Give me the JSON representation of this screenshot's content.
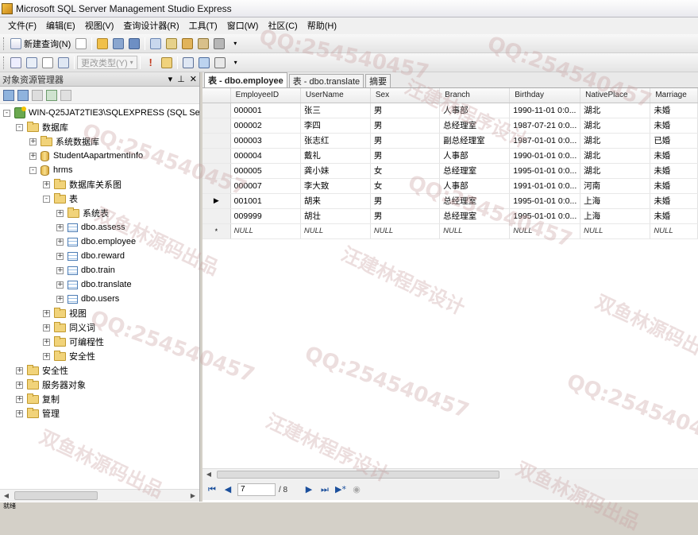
{
  "window": {
    "title": "Microsoft SQL Server Management Studio Express"
  },
  "menu": [
    "文件(F)",
    "编辑(E)",
    "视图(V)",
    "查询设计器(R)",
    "工具(T)",
    "窗口(W)",
    "社区(C)",
    "帮助(H)"
  ],
  "toolbar": {
    "new_query": "新建查询(N)",
    "change_type": "更改类型(Y)"
  },
  "object_explorer": {
    "title": "对象资源管理器",
    "pin": "▼ 📌 ✕",
    "tree": [
      {
        "label": "WIN-Q25JAT2TIE3\\SQLEXPRESS (SQL Ser",
        "icon": "server-icon",
        "exp": "-"
      },
      {
        "label": "数据库",
        "icon": "folder-icon",
        "exp": "-"
      },
      {
        "label": "系统数据库",
        "icon": "folder-icon",
        "exp": "+"
      },
      {
        "label": "StudentAapartmentInfo",
        "icon": "database-icon",
        "exp": "+"
      },
      {
        "label": "hrms",
        "icon": "database-icon",
        "exp": "-"
      },
      {
        "label": "数据库关系图",
        "icon": "folder-icon",
        "exp": "+"
      },
      {
        "label": "表",
        "icon": "folder-icon",
        "exp": "-"
      },
      {
        "label": "系统表",
        "icon": "folder-icon",
        "exp": "+"
      },
      {
        "label": "dbo.assess",
        "icon": "table-icon",
        "exp": "+"
      },
      {
        "label": "dbo.employee",
        "icon": "table-icon",
        "exp": "+"
      },
      {
        "label": "dbo.reward",
        "icon": "table-icon",
        "exp": "+"
      },
      {
        "label": "dbo.train",
        "icon": "table-icon",
        "exp": "+"
      },
      {
        "label": "dbo.translate",
        "icon": "table-icon",
        "exp": "+"
      },
      {
        "label": "dbo.users",
        "icon": "table-icon",
        "exp": "+"
      },
      {
        "label": "视图",
        "icon": "folder-icon",
        "exp": "+"
      },
      {
        "label": "同义词",
        "icon": "folder-icon",
        "exp": "+"
      },
      {
        "label": "可编程性",
        "icon": "folder-icon",
        "exp": "+"
      },
      {
        "label": "安全性",
        "icon": "folder-icon",
        "exp": "+"
      },
      {
        "label": "安全性",
        "icon": "folder-icon",
        "exp": "+"
      },
      {
        "label": "服务器对象",
        "icon": "folder-icon",
        "exp": "+"
      },
      {
        "label": "复制",
        "icon": "folder-icon",
        "exp": "+"
      },
      {
        "label": "管理",
        "icon": "folder-icon",
        "exp": "+"
      }
    ]
  },
  "tabs": [
    "表 - dbo.employee",
    "表 - dbo.translate",
    "摘要"
  ],
  "grid": {
    "columns": [
      "EmployeeID",
      "UserName",
      "Sex",
      "Branch",
      "Birthday",
      "NativePlace",
      "Marriage"
    ],
    "rows": [
      [
        "000001",
        "张三",
        "男",
        "人事部",
        "1990-11-01 0:0...",
        "湖北",
        "未婚"
      ],
      [
        "000002",
        "李四",
        "男",
        "总经理室",
        "1987-07-21 0:0...",
        "湖北",
        "未婚"
      ],
      [
        "000003",
        "张志红",
        "男",
        "副总经理室",
        "1987-01-01 0:0...",
        "湖北",
        "已婚"
      ],
      [
        "000004",
        "戴礼",
        "男",
        "人事部",
        "1990-01-01 0:0...",
        "湖北",
        "未婚"
      ],
      [
        "000005",
        "龚小妹",
        "女",
        "总经理室",
        "1995-01-01 0:0...",
        "湖北",
        "未婚"
      ],
      [
        "000007",
        "李大致",
        "女",
        "人事部",
        "1991-01-01 0:0...",
        "河南",
        "未婚"
      ],
      [
        "001001",
        "胡来",
        "男",
        "总经理室",
        "1995-01-01 0:0...",
        "上海",
        "未婚"
      ],
      [
        "009999",
        "胡壮",
        "男",
        "总经理室",
        "1995-01-01 0:0...",
        "上海",
        "未婚"
      ]
    ],
    "null_row": [
      "NULL",
      "NULL",
      "NULL",
      "NULL",
      "NULL",
      "NULL",
      "NULL"
    ],
    "current_row_marker": "▶",
    "new_row_marker": "*",
    "current_row": 7
  },
  "nav": {
    "position": "7",
    "of": "/ 8"
  },
  "status": {
    "text": "就绪"
  },
  "watermarks": [
    "QQ:254540457",
    "汪建林程序设计",
    "双鱼林源码出品"
  ]
}
